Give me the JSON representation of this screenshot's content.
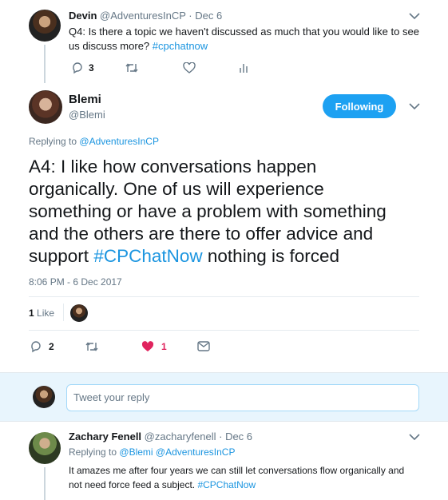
{
  "tweet1": {
    "name": "Devin",
    "handle": "@AdventuresInCP",
    "sep": "·",
    "date": "Dec 6",
    "text": "Q4: Is there a topic we haven't discussed as much that you would like to see us discuss more?",
    "hashtag": "#cpchatnow",
    "reply_count": "3"
  },
  "main": {
    "name": "Blemi",
    "handle": "@Blemi",
    "follow_label": "Following",
    "replying_label": "Replying to",
    "replying_handle": "@AdventuresInCP",
    "text_lines": [
      "A4: I like how conversations happen",
      "organically. One of us will experience",
      "something or have a problem with something",
      "and the others are there to offer advice and"
    ],
    "last_line_prefix": "support",
    "hashtag": "#CPChatNow",
    "last_line_suffix": "nothing is forced",
    "timestamp": "8:06 PM - 6 Dec 2017",
    "likes_count": "1",
    "likes_label": "Like",
    "reply_count": "2",
    "heart_count": "1"
  },
  "reply_box": {
    "placeholder": "Tweet your reply"
  },
  "tweet3": {
    "name": "Zachary Fenell",
    "handle": "@zacharyfenell",
    "sep": "·",
    "date": "Dec 6",
    "replying_label": "Replying to",
    "replying_handles": "@Blemi @AdventuresInCP",
    "text_line1": "It amazes me after four years we can still let conversations flow organically and",
    "text_line2_prefix": "not need force feed a subject.",
    "hashtag": "#CPChatNow"
  },
  "colors": {
    "link": "#1b95e0",
    "heart": "#e0245e",
    "muted": "#657786",
    "follow_button": "#1da1f2"
  }
}
